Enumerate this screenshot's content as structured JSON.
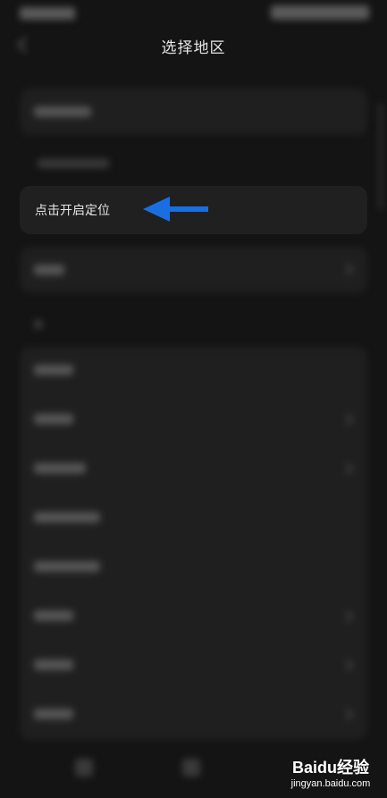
{
  "header": {
    "title": "选择地区"
  },
  "location": {
    "label": "点击开启定位"
  },
  "colors": {
    "background": "#141414",
    "card": "#1f1f1f",
    "arrow": "#1a6fe0"
  },
  "icons": {
    "back": "back-arrow-icon",
    "pointer": "arrow-left-icon"
  },
  "watermark": {
    "logo": "Baidu经验",
    "url": "jingyan.baidu.com"
  },
  "list": {
    "rows": 8
  }
}
